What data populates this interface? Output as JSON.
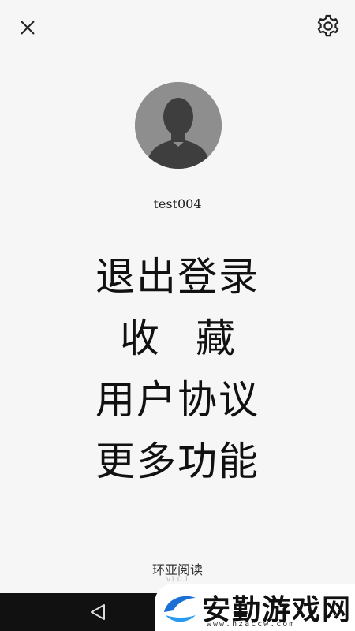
{
  "header": {
    "close_icon": "close-icon",
    "settings_icon": "gear-icon"
  },
  "profile": {
    "avatar_icon": "default-avatar",
    "username": "test004"
  },
  "menu": {
    "items": [
      {
        "label": "退出登录"
      },
      {
        "label": "收藏"
      },
      {
        "label": "用户协议"
      },
      {
        "label": "更多功能"
      }
    ]
  },
  "footer": {
    "app_name": "环亚阅读",
    "version": "v1.0.1"
  },
  "navbar": {
    "back_icon": "back-triangle-icon"
  },
  "watermark": {
    "text": "安勤游戏网",
    "url": "www.hzaccw.com"
  },
  "colors": {
    "background": "#f6f6f6",
    "avatar_bg": "#8e8e8e",
    "navbar": "#111111"
  }
}
